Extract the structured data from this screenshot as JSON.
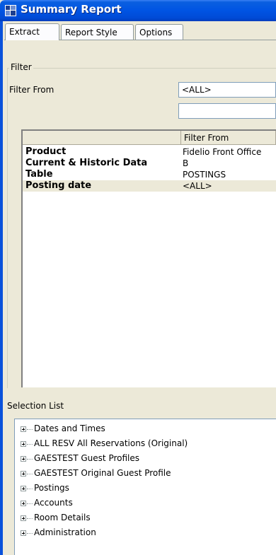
{
  "window": {
    "title": "Summary Report"
  },
  "tabs": [
    {
      "label": "Extract"
    },
    {
      "label": "Report Style"
    },
    {
      "label": "Options"
    }
  ],
  "filter": {
    "legend": "Filter",
    "from_label": "Filter From",
    "from_value": "<ALL>",
    "extra_value": ""
  },
  "grid": {
    "header": "Filter From",
    "rows": [
      {
        "label": "Product",
        "value": "Fidelio Front Office"
      },
      {
        "label": "Current & Historic Data",
        "value": "B"
      },
      {
        "label": "Table",
        "value": "POSTINGS"
      },
      {
        "label": "Posting date",
        "value": "<ALL>"
      }
    ]
  },
  "selection": {
    "label": "Selection List",
    "items": [
      {
        "label": "Dates and Times"
      },
      {
        "label": "ALL RESV  All Reservations (Original)"
      },
      {
        "label": "GAESTEST  Guest Profiles"
      },
      {
        "label": "GAESTEST  Original Guest Profile"
      },
      {
        "label": "Postings"
      },
      {
        "label": "Accounts"
      },
      {
        "label": "Room Details"
      },
      {
        "label": "Administration"
      }
    ]
  },
  "colors": {
    "titlebar": "#0054e3",
    "dialog_bg": "#ece9d8",
    "selected_row": "#ece9d8"
  }
}
